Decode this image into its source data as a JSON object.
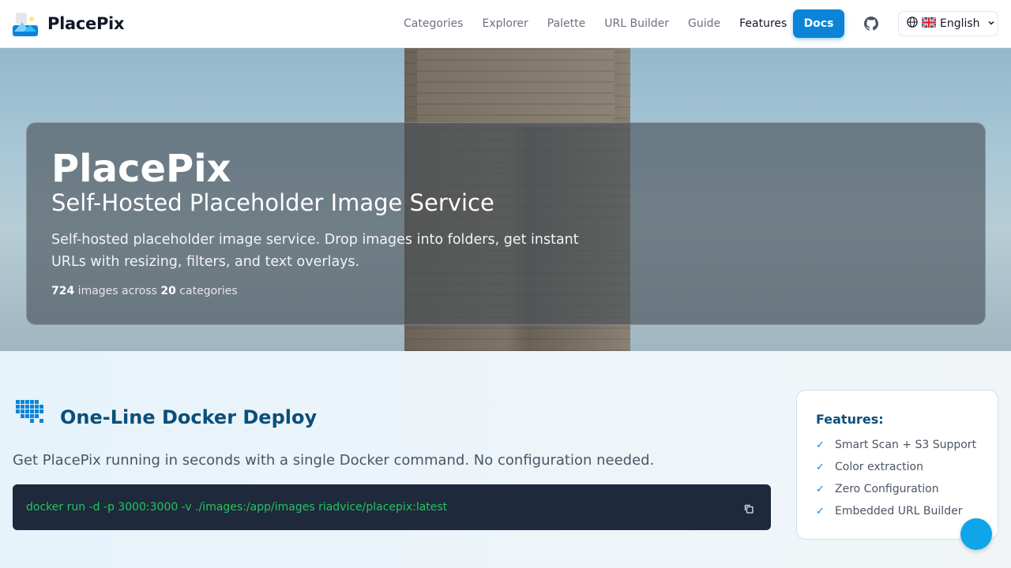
{
  "brand": {
    "name": "PlacePix",
    "logo_icon": "image-logo-icon"
  },
  "nav": {
    "links": [
      "Categories",
      "Explorer",
      "Palette",
      "URL Builder",
      "Guide",
      "Features"
    ],
    "docs_label": "Docs",
    "github_icon": "github-icon",
    "language": "English"
  },
  "hero": {
    "title": "PlacePix",
    "subtitle": "Self-Hosted Placeholder Image Service",
    "description": "Self-hosted placeholder image service. Drop images into folders, get instant URLs with resizing, filters, and text overlays.",
    "stats": {
      "images": "724",
      "images_text": " images across ",
      "categories": "20",
      "categories_text": " categories"
    }
  },
  "docker": {
    "title": "One-Line Docker Deploy",
    "description": "Get PlacePix running in seconds with a single Docker command. No configuration needed.",
    "command": "docker run -d -p 3000:3000 -v ./images:/app/images riadvice/placepix:latest"
  },
  "features": {
    "title": "Features:",
    "items": [
      "Smart Scan + S3 Support",
      "Color extraction",
      "Zero Configuration",
      "Embedded URL Builder"
    ]
  },
  "colors": {
    "accent": "#0b84d8",
    "heading": "#0b4f7a",
    "code_bg": "#1e293b",
    "code_text": "#22c55e"
  }
}
